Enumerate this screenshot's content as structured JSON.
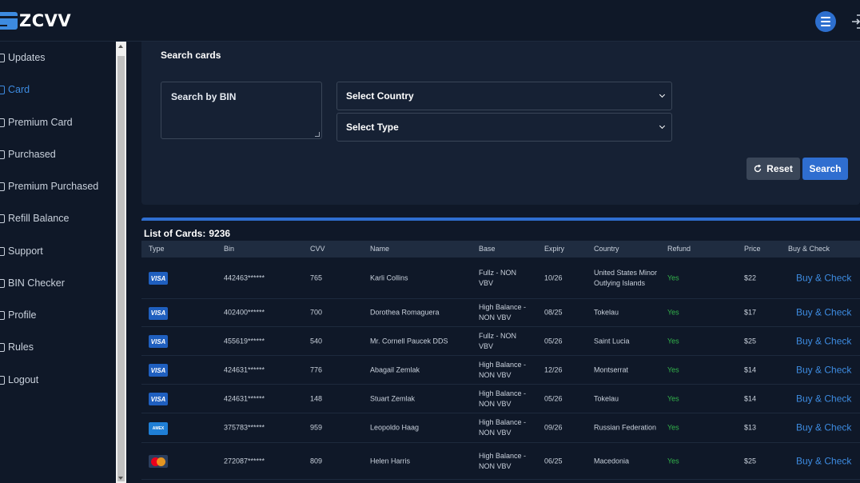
{
  "app": {
    "logo_text": "ZCVV"
  },
  "sidebar": {
    "items": [
      {
        "label": "Updates"
      },
      {
        "label": "Card",
        "active": true
      },
      {
        "label": "Premium Card"
      },
      {
        "label": "Purchased"
      },
      {
        "label": "Premium Purchased"
      },
      {
        "label": "Refill Balance"
      },
      {
        "label": "Support"
      },
      {
        "label": "BIN Checker"
      },
      {
        "label": "Profile"
      },
      {
        "label": "Rules"
      },
      {
        "label": "Logout"
      }
    ]
  },
  "search": {
    "title": "Search cards",
    "bin_placeholder": "Search by BIN",
    "country_select": "Select Country",
    "type_select": "Select Type",
    "reset_label": "Reset",
    "search_label": "Search"
  },
  "list": {
    "title": "List of Cards:",
    "count": "9236",
    "columns": [
      "Type",
      "Bin",
      "CVV",
      "Name",
      "Base",
      "Expiry",
      "Country",
      "Refund",
      "Price",
      "Buy & Check"
    ],
    "rows": [
      {
        "type": "VISA",
        "bin": "442463******",
        "cvv": "765",
        "name": "Karli Collins",
        "base": "Fullz - NON VBV",
        "expiry": "10/26",
        "country": "United States Minor Outlying Islands",
        "refund": "Yes",
        "price": "$22",
        "action": "Buy & Check"
      },
      {
        "type": "VISA",
        "bin": "402400******",
        "cvv": "700",
        "name": "Dorothea Romaguera",
        "base": "High Balance - NON VBV",
        "expiry": "08/25",
        "country": "Tokelau",
        "refund": "Yes",
        "price": "$17",
        "action": "Buy & Check"
      },
      {
        "type": "VISA",
        "bin": "455619******",
        "cvv": "540",
        "name": "Mr. Cornell Paucek DDS",
        "base": "Fullz - NON VBV",
        "expiry": "05/26",
        "country": "Saint Lucia",
        "refund": "Yes",
        "price": "$25",
        "action": "Buy & Check"
      },
      {
        "type": "VISA",
        "bin": "424631******",
        "cvv": "776",
        "name": "Abagail Zemlak",
        "base": "High Balance - NON VBV",
        "expiry": "12/26",
        "country": "Montserrat",
        "refund": "Yes",
        "price": "$14",
        "action": "Buy & Check"
      },
      {
        "type": "VISA",
        "bin": "424631******",
        "cvv": "148",
        "name": "Stuart Zemlak",
        "base": "High Balance - NON VBV",
        "expiry": "05/26",
        "country": "Tokelau",
        "refund": "Yes",
        "price": "$14",
        "action": "Buy & Check"
      },
      {
        "type": "AMEX",
        "bin": "375783******",
        "cvv": "959",
        "name": "Leopoldo Haag",
        "base": "High Balance - NON VBV",
        "expiry": "09/26",
        "country": "Russian Federation",
        "refund": "Yes",
        "price": "$13",
        "action": "Buy & Check"
      },
      {
        "type": "MASTERCARD",
        "bin": "272087******",
        "cvv": "809",
        "name": "Helen Harris",
        "base": "High Balance - NON VBV",
        "expiry": "06/25",
        "country": "Macedonia",
        "refund": "Yes",
        "price": "$25",
        "action": "Buy & Check"
      }
    ]
  },
  "colors": {
    "accent": "#2f6ed0",
    "background": "#0f1828",
    "panel": "#162134",
    "refund_yes": "#32b34a",
    "link": "#3d8be0"
  },
  "icons": {
    "menu": "hamburger-icon",
    "exit": "logout-icon",
    "reset": "refresh-icon"
  }
}
